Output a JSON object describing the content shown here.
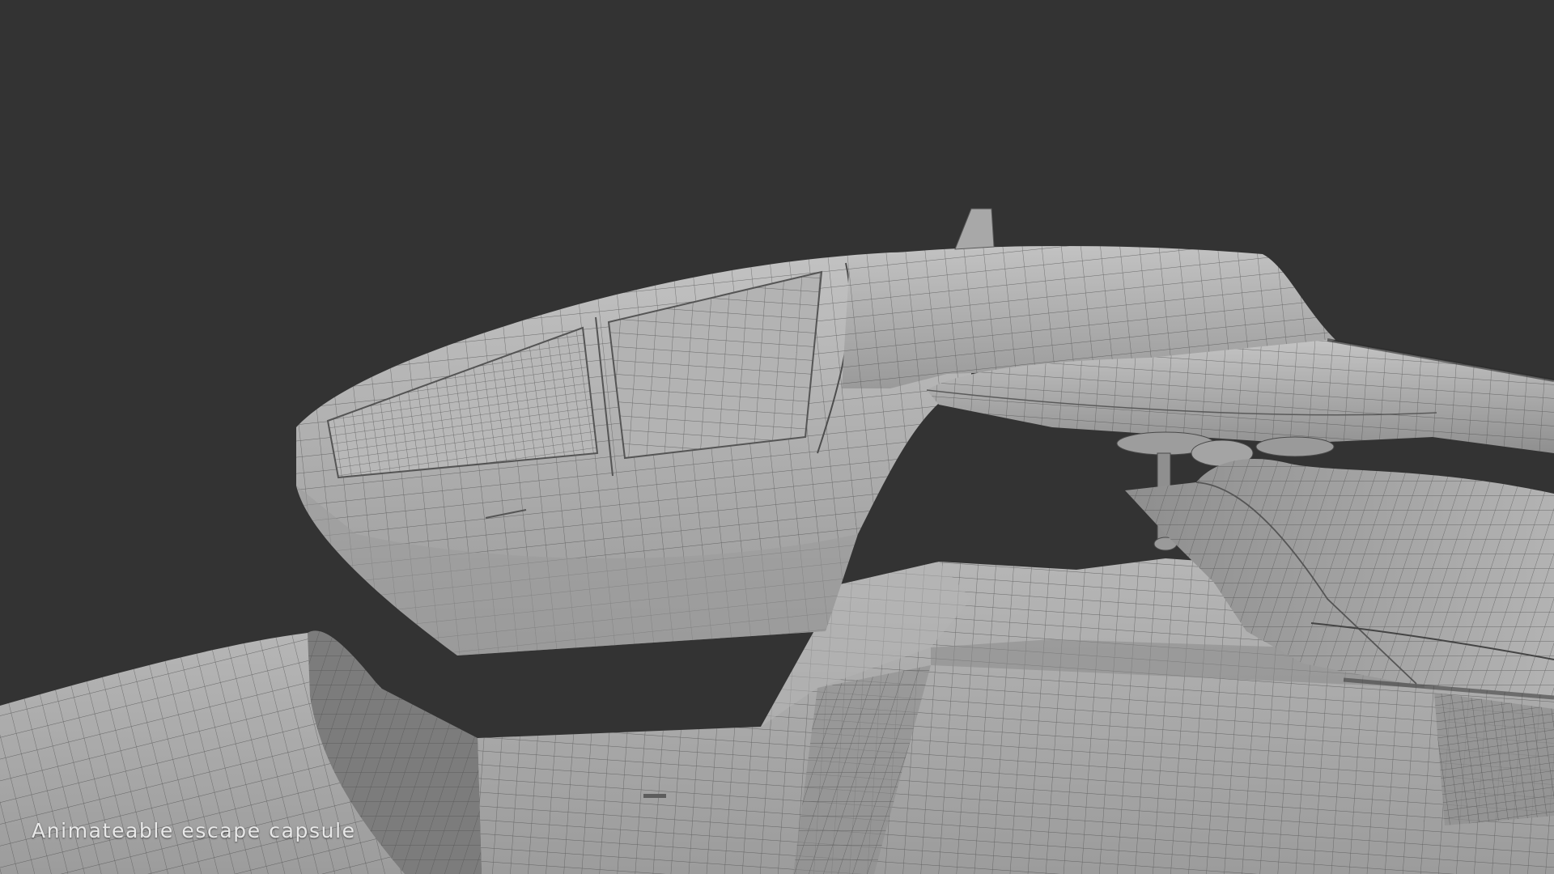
{
  "caption": "Animateable escape capsule",
  "scene": {
    "background_color": "#333333",
    "mesh_color": "#a9a9a9",
    "wire_color": "#4a4a4a",
    "subject": "wireframe-mesh"
  }
}
